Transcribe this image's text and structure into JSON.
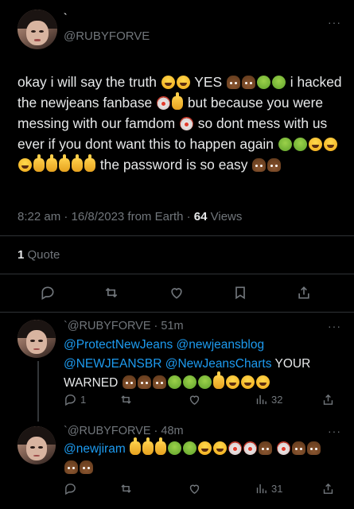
{
  "main_tweet": {
    "tick": "`",
    "handle": "@RUBYFORVE",
    "more": "···",
    "text_parts": [
      "okay i will say the truth ",
      " YES ",
      " i hacked the newjeans fanbase ",
      " but because you were messing with our famdom ",
      " so dont mess with us ever if you dont want this to happen again ",
      " the password is so easy "
    ],
    "meta": "8:22 am · 16/8/2023 from Earth · ",
    "views_count": "64",
    "views_label": " Views",
    "quote_count": "1",
    "quote_label": " Quote"
  },
  "reply1": {
    "handle": "`@RUBYFORVE · 51m",
    "more": "···",
    "mentions": [
      "@ProtectNewJeans",
      "@newjeansblog",
      "@NEWJEANSBR",
      "@NewJeansCharts"
    ],
    "text_tail": "YOUR WARNED",
    "reply_count": "1",
    "views": "32"
  },
  "reply2": {
    "handle": "`@RUBYFORVE · 48m",
    "more": "···",
    "mention": "@newjiram",
    "views": "31"
  },
  "icons": {
    "reply": "reply-icon",
    "retweet": "retweet-icon",
    "like": "heart-icon",
    "bookmark": "bookmark-icon",
    "share": "share-icon",
    "views": "views-icon"
  },
  "colors": {
    "background": "#000000",
    "text": "#e7e9ea",
    "muted": "#71767b",
    "link": "#1d9bf0",
    "divider": "#2f3336"
  }
}
